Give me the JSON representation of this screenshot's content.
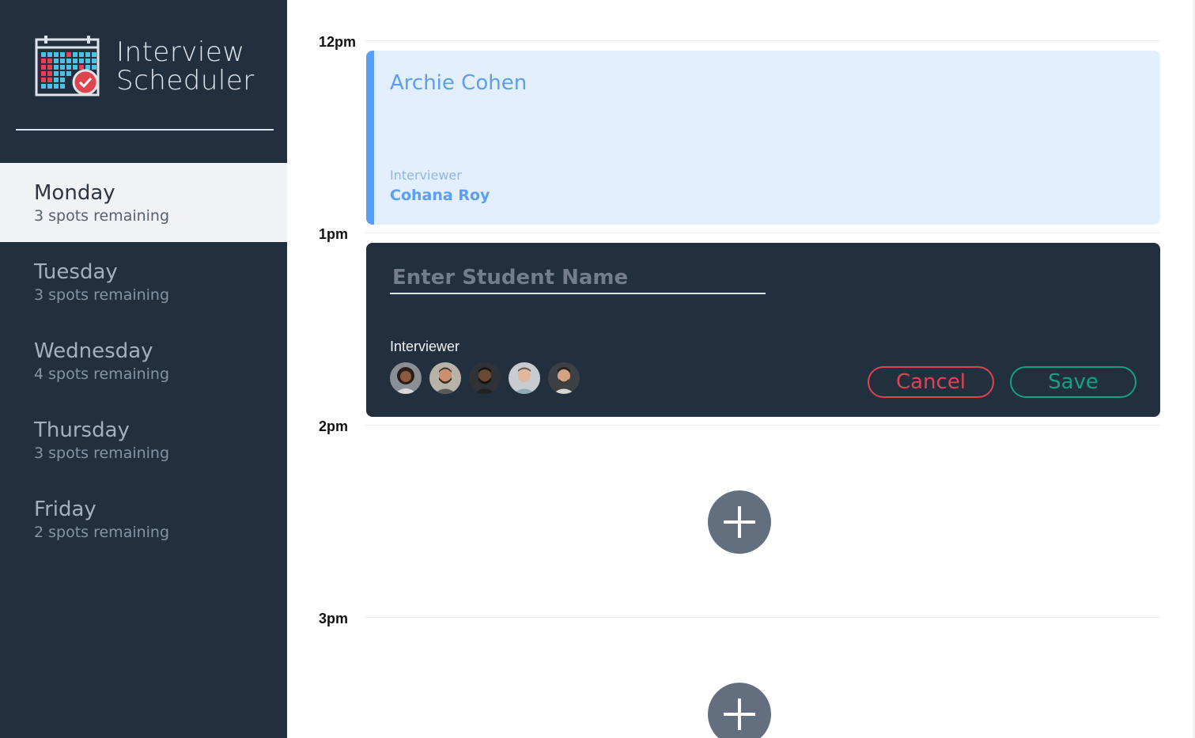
{
  "app": {
    "title_line1": "Interview",
    "title_line2": "Scheduler"
  },
  "days": [
    {
      "name": "Monday",
      "spots": "3 spots remaining",
      "selected": true
    },
    {
      "name": "Tuesday",
      "spots": "3 spots remaining",
      "selected": false
    },
    {
      "name": "Wednesday",
      "spots": "4 spots remaining",
      "selected": false
    },
    {
      "name": "Thursday",
      "spots": "3 spots remaining",
      "selected": false
    },
    {
      "name": "Friday",
      "spots": "2 spots remaining",
      "selected": false
    }
  ],
  "schedule": {
    "times": [
      "12pm",
      "1pm",
      "2pm",
      "3pm"
    ],
    "booked": {
      "student": "Archie Cohen",
      "interviewer_label": "Interviewer",
      "interviewer_name": "Cohana Roy"
    },
    "form": {
      "student_placeholder": "Enter Student Name",
      "student_value": "",
      "interviewer_label": "Interviewer",
      "cancel_label": "Cancel",
      "save_label": "Save"
    }
  },
  "colors": {
    "sidebar_bg": "#222f3e",
    "booked_bg": "#e3effd",
    "booked_accent": "#5b9ef3",
    "cancel": "#e0444e",
    "save": "#15a085",
    "add_button": "#636e7e"
  },
  "icons": {
    "logo": "calendar-check-icon",
    "add": "plus-icon",
    "avatar": "interviewer-avatar"
  }
}
